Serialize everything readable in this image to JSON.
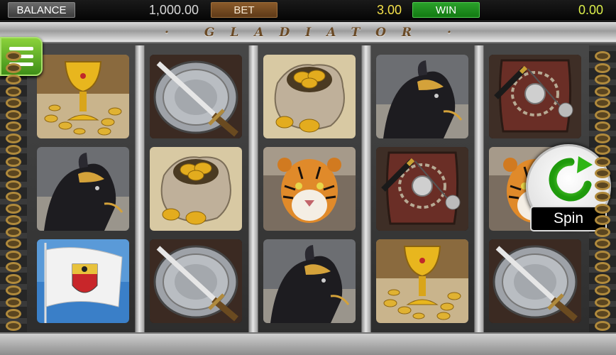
{
  "hud": {
    "balance_label": "BALANCE",
    "balance_value": "1,000.00",
    "bet_label": "BET",
    "bet_value": "3.00",
    "win_label": "WIN",
    "win_value": "0.00"
  },
  "title": "· GLADIATOR ·",
  "menu": {
    "icon": "hamburger-menu-icon"
  },
  "spin": {
    "label": "Spin",
    "icon": "refresh-arrow-icon",
    "color": "#39c21c"
  },
  "reels": [
    [
      "goblet",
      "horse",
      "flag"
    ],
    [
      "shield-sword",
      "coin-bag",
      "shield-sword"
    ],
    [
      "coin-bag",
      "tiger",
      "horse"
    ],
    [
      "horse",
      "shield-mace",
      "goblet"
    ],
    [
      "shield-mace",
      "tiger",
      "shield-sword"
    ]
  ],
  "colors": {
    "accent_green": "#4fb024",
    "bet_brown": "#7a4a20",
    "win_green": "#1f8f1f",
    "gold": "#d4a21e"
  }
}
